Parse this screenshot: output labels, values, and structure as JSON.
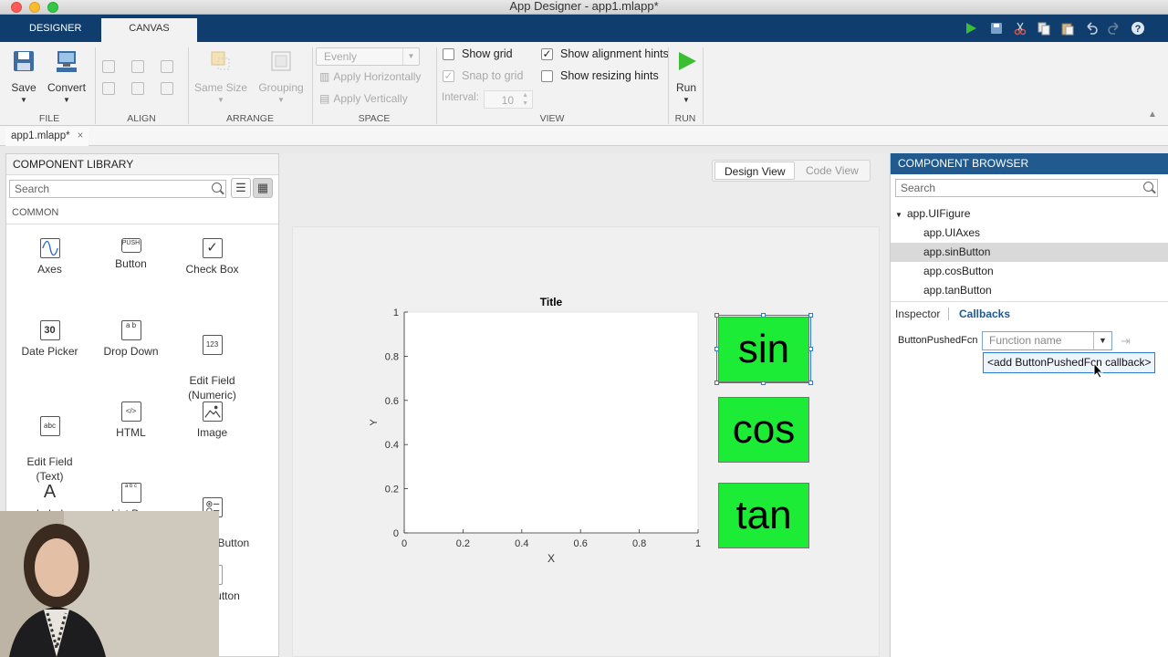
{
  "window": {
    "title": "App Designer - app1.mlapp*"
  },
  "toolstrip": {
    "tabs": [
      {
        "label": "DESIGNER"
      },
      {
        "label": "CANVAS"
      }
    ]
  },
  "ribbon": {
    "file": {
      "save": "Save",
      "convert": "Convert",
      "group": "FILE"
    },
    "align": {
      "group": "ALIGN"
    },
    "arrange": {
      "same_size": "Same Size",
      "grouping": "Grouping",
      "group": "ARRANGE"
    },
    "space": {
      "evenly": "Evenly",
      "apply_h": "Apply Horizontally",
      "apply_v": "Apply Vertically",
      "group": "SPACE"
    },
    "view": {
      "show_grid": "Show grid",
      "snap_to_grid": "Snap to grid",
      "interval_label": "Interval:",
      "interval_value": "10",
      "show_alignment_hints": "Show alignment hints",
      "show_resizing_hints": "Show resizing hints",
      "group": "VIEW"
    },
    "run": {
      "label": "Run",
      "group": "RUN"
    }
  },
  "file_tab": {
    "label": "app1.mlapp*",
    "close": "×"
  },
  "library": {
    "title": "COMPONENT LIBRARY",
    "search_placeholder": "Search",
    "section": "COMMON",
    "items": [
      {
        "label": "Axes",
        "icon": "axes-icon"
      },
      {
        "label": "Button",
        "icon": "push-button-icon",
        "icon_text": "PUSH"
      },
      {
        "label": "Check Box",
        "icon": "checkbox-icon"
      },
      {
        "label": "Date Picker",
        "icon": "calendar-icon",
        "icon_text": "30"
      },
      {
        "label": "Drop Down",
        "icon": "dropdown-icon",
        "icon_text": "a b"
      },
      {
        "label": "Edit Field\n(Numeric)",
        "icon": "numeric-field-icon",
        "icon_text": "123"
      },
      {
        "label": "Edit Field\n(Text)",
        "icon": "text-field-icon",
        "icon_text": "abc"
      },
      {
        "label": "HTML",
        "icon": "html-icon",
        "icon_text": "</>"
      },
      {
        "label": "Image",
        "icon": "image-icon"
      },
      {
        "label": "Label",
        "icon": "label-icon",
        "icon_text": "A"
      },
      {
        "label": "List Box",
        "icon": "listbox-icon",
        "icon_text": "a b c"
      },
      {
        "label": "Radio Button\np",
        "icon": "radio-group-icon"
      }
    ],
    "partial_item": "utton"
  },
  "canvas": {
    "design_view": "Design View",
    "code_view": "Code View",
    "buttons": [
      {
        "label": "sin"
      },
      {
        "label": "cos"
      },
      {
        "label": "tan"
      }
    ]
  },
  "chart_data": {
    "type": "line",
    "title": "Title",
    "xlabel": "X",
    "ylabel": "Y",
    "xlim": [
      0,
      1
    ],
    "ylim": [
      0,
      1
    ],
    "xticks": [
      "0",
      "0.2",
      "0.4",
      "0.6",
      "0.8",
      "1"
    ],
    "yticks": [
      "0",
      "0.2",
      "0.4",
      "0.6",
      "0.8",
      "1"
    ],
    "series": []
  },
  "browser": {
    "title": "COMPONENT BROWSER",
    "search_placeholder": "Search",
    "tree": [
      {
        "label": "app.UIFigure",
        "level": 0
      },
      {
        "label": "app.UIAxes",
        "level": 1
      },
      {
        "label": "app.sinButton",
        "level": 1,
        "selected": true
      },
      {
        "label": "app.cosButton",
        "level": 1
      },
      {
        "label": "app.tanButton",
        "level": 1
      }
    ],
    "tabs": {
      "inspector": "Inspector",
      "callbacks": "Callbacks"
    },
    "property_label": "ButtonPushedFcn",
    "function_placeholder": "Function name",
    "dropdown_option": "<add ButtonPushedFcn callback>"
  },
  "colors": {
    "toolstrip_bg": "#0f3e6e",
    "browser_header": "#205a8f",
    "button_green": "#1cec36",
    "selection_blue": "#2a7bd6",
    "run_green": "#3cbe32"
  }
}
